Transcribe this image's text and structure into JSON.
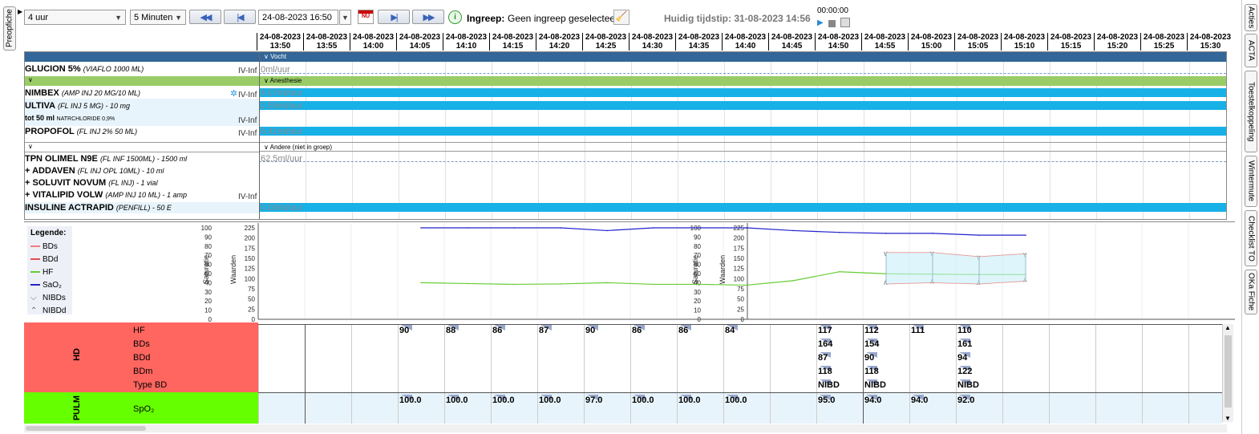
{
  "left_tab": "Preopfiche",
  "right_tabs": [
    "Acties",
    "ACTA",
    "Toestelkoppeling",
    "Wintermute",
    "Checklist TO",
    "OKa Fiche"
  ],
  "toolbar": {
    "range_select": "4 uur",
    "interval_select": "5 Minuten",
    "datetime_value": "24-08-2023 16:50",
    "nu_label": "NU",
    "ingreep_label": "Ingreep:",
    "ingreep_value": "Geen ingreep geselecteerd",
    "huidig_tijdstip": "Huidig tijdstip: 31-08-2023 14:56",
    "timer": "00:00:00"
  },
  "time_columns": [
    {
      "date": "24-08-2023",
      "time": "13:50"
    },
    {
      "date": "24-08-2023",
      "time": "13:55"
    },
    {
      "date": "24-08-2023",
      "time": "14:00"
    },
    {
      "date": "24-08-2023",
      "time": "14:05"
    },
    {
      "date": "24-08-2023",
      "time": "14:10"
    },
    {
      "date": "24-08-2023",
      "time": "14:15"
    },
    {
      "date": "24-08-2023",
      "time": "14:20"
    },
    {
      "date": "24-08-2023",
      "time": "14:25"
    },
    {
      "date": "24-08-2023",
      "time": "14:30"
    },
    {
      "date": "24-08-2023",
      "time": "14:35"
    },
    {
      "date": "24-08-2023",
      "time": "14:40"
    },
    {
      "date": "24-08-2023",
      "time": "14:45"
    },
    {
      "date": "24-08-2023",
      "time": "14:50"
    },
    {
      "date": "24-08-2023",
      "time": "14:55"
    },
    {
      "date": "24-08-2023",
      "time": "15:00"
    },
    {
      "date": "24-08-2023",
      "time": "15:05"
    },
    {
      "date": "24-08-2023",
      "time": "15:10"
    },
    {
      "date": "24-08-2023",
      "time": "15:15"
    },
    {
      "date": "24-08-2023",
      "time": "15:20"
    },
    {
      "date": "24-08-2023",
      "time": "15:25"
    },
    {
      "date": "24-08-2023",
      "time": "15:30"
    }
  ],
  "groups": {
    "vocht": "Vocht",
    "anesthesie": "Anesthesie",
    "andere": "Andere (niet in groep)"
  },
  "meds": {
    "glucion": {
      "name": "GLUCION  5%",
      "detail": "(VIAFLO 1000 ML)",
      "route": "IV-Inf",
      "rate": "0ml/uur"
    },
    "nimbex": {
      "name": "NIMBEX",
      "detail": "(AMP INJ 20 MG/10 ML)",
      "route": "IV-Inf",
      "rate": "4.07ml/uur"
    },
    "ultiva": {
      "name": "ULTIVA",
      "detail": "(FL INJ 5 MG)  -  10 mg",
      "extra": "tot 50 ml",
      "extra2": "NATRCHLORIDE 0,9%",
      "route": "IV-Inf",
      "rate": "2.59ml/uur"
    },
    "propofol": {
      "name": "PROPOFOL",
      "detail": "(FL INJ 2%  50 ML)",
      "route": "IV-Inf",
      "rate": "6.41ml/uur"
    },
    "tpn": {
      "name": "TPN OLIMEL N9E",
      "detail": "(FL INF 1500ML)  -  1500 ml",
      "rate": "62.5ml/uur"
    },
    "addaven": {
      "name": "+ ADDAVEN",
      "detail": "(FL INJ OPL 10ML)  -  10 ml"
    },
    "soluvit": {
      "name": "+ SOLUVIT NOVUM",
      "detail": "(FL INJ)  -  1 vial"
    },
    "vitalipid": {
      "name": "+ VITALIPID VOLW",
      "detail": "(AMP INJ 10 ML)  -  1 amp",
      "route": "IV-Inf"
    },
    "insuline": {
      "name": "INSULINE ACTRAPID",
      "detail": "(PENFILL)  -  50 E",
      "rate": "0.00ml/uur"
    }
  },
  "legend": {
    "title": "Legende:",
    "items": [
      "BDs",
      "BDd",
      "HF",
      "SaO₂",
      "NIBDs",
      "NIBDd"
    ],
    "colors": [
      "#f08080",
      "#e05050",
      "#66cc33",
      "#2222cc",
      "#888888",
      "#888888"
    ]
  },
  "chart_data": {
    "type": "line",
    "title": "",
    "ylabel_left": "Saturatie",
    "ylabel_right": "Waarden",
    "saturatie_ticks": [
      0,
      10,
      20,
      30,
      40,
      50,
      60,
      70,
      80,
      90,
      100
    ],
    "waarden_ticks": [
      0,
      25,
      50,
      75,
      100,
      125,
      150,
      175,
      200,
      225
    ],
    "x": [
      "14:05",
      "14:10",
      "14:15",
      "14:20",
      "14:25",
      "14:30",
      "14:35",
      "14:40",
      "14:45",
      "14:50",
      "14:55",
      "15:00",
      "15:05",
      "15:10"
    ],
    "series": [
      {
        "name": "SaO₂",
        "axis": "saturatie",
        "values": [
          100,
          100,
          100,
          100,
          97,
          100,
          100,
          100,
          97,
          95,
          94,
          94,
          92,
          92
        ]
      },
      {
        "name": "HF",
        "axis": "waarden",
        "values": [
          90,
          88,
          86,
          87,
          90,
          86,
          86,
          84,
          95,
          117,
          112,
          111,
          110,
          110
        ]
      },
      {
        "name": "NIBDs",
        "axis": "waarden",
        "x": [
          "14:55",
          "15:00",
          "15:05",
          "15:10"
        ],
        "values": [
          164,
          164,
          154,
          161
        ]
      },
      {
        "name": "NIBDd",
        "axis": "waarden",
        "x": [
          "14:55",
          "15:00",
          "15:05",
          "15:10"
        ],
        "values": [
          87,
          90,
          87,
          94
        ]
      }
    ]
  },
  "table": {
    "hd_label": "HD",
    "pulm_label": "PULM",
    "rows": [
      {
        "label": "HF",
        "cells": {
          "3": "90",
          "4": "88",
          "5": "86",
          "6": "87",
          "7": "90",
          "8": "86",
          "9": "86",
          "10": "84",
          "12": "117",
          "13": "112",
          "14": "111",
          "15": "110"
        }
      },
      {
        "label": "BDs",
        "cells": {
          "12": "164",
          "13": "154",
          "15": "161"
        }
      },
      {
        "label": "BDd",
        "cells": {
          "12": "87",
          "13": "90",
          "15": "94"
        }
      },
      {
        "label": "BDm",
        "cells": {
          "12": "118",
          "13": "118",
          "15": "122"
        }
      },
      {
        "label": "Type BD",
        "cells": {
          "12": "NIBD",
          "13": "NIBD",
          "15": "NIBD"
        }
      },
      {
        "label": "SpO₂",
        "cells": {
          "3": "100.0",
          "4": "100.0",
          "5": "100.0",
          "6": "100.0",
          "7": "97.0",
          "8": "100.0",
          "9": "100.0",
          "10": "100.0",
          "12": "95.0",
          "13": "94.0",
          "14": "94.0",
          "15": "92.0"
        }
      }
    ]
  }
}
